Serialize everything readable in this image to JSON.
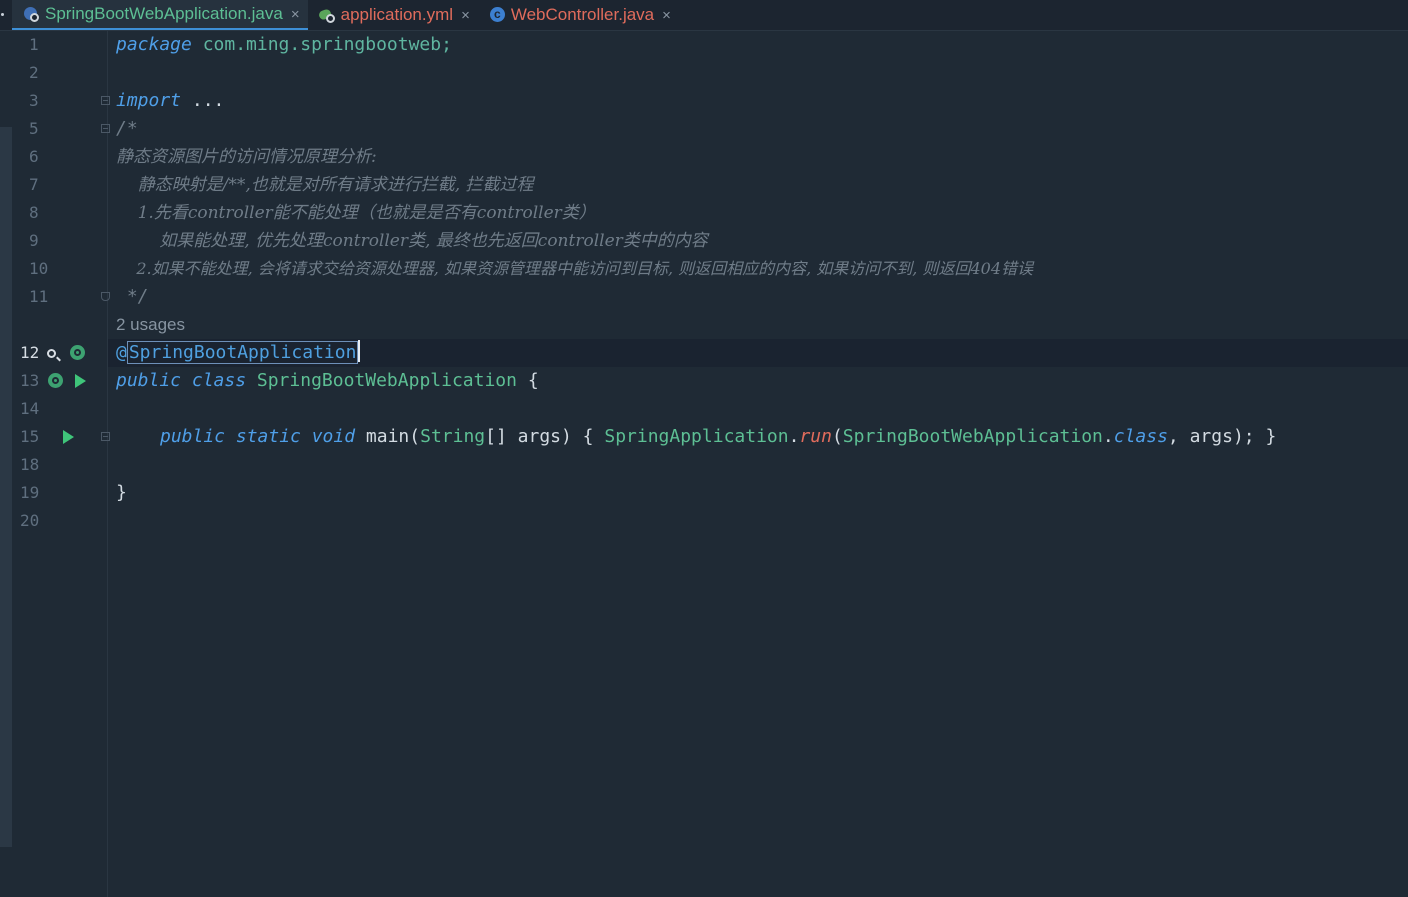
{
  "tabs": [
    {
      "label": "SpringBootWebApplication.java",
      "icon": "spring-boot-icon",
      "color": "#5dbf94",
      "active": true
    },
    {
      "label": "application.yml",
      "icon": "yml-icon",
      "color": "#e06c5c",
      "active": false
    },
    {
      "label": "WebController.java",
      "icon": "java-class-icon",
      "color": "#e06c5c",
      "active": false
    }
  ],
  "close_glyph": "×",
  "line_numbers": [
    "1",
    "2",
    "3",
    "5",
    "6",
    "7",
    "8",
    "9",
    "10",
    "11",
    "12",
    "13",
    "14",
    "15",
    "18",
    "19",
    "20"
  ],
  "code": {
    "l1_kw": "package",
    "l1_pkg": " com.ming.springbootweb;",
    "l3_kw": "import",
    "l3_rest": " ...",
    "l5": "/*",
    "l6": "静态资源图片的访问情况原理分析:",
    "l7": "    静态映射是/**,也就是对所有请求进行拦截, 拦截过程",
    "l8": "    1.先看controller能不能处理（也就是是否有controller类）",
    "l9": "        如果能处理, 优先处理controller类, 最终也先返回controller类中的内容",
    "l10": "    2.如果不能处理, 会将请求交给资源处理器, 如果资源管理器中能访问到目标, 则返回相应的内容, 如果访问不到, 则返回404错误",
    "l11": " */",
    "usages": "2 usages",
    "l12_at": "@",
    "l12_name": "SpringBootApplication",
    "l13_kw": "public class",
    "l13_cls": " SpringBootWebApplication",
    "l13_brace": " {",
    "l15_kw1": "public static void",
    "l15_mth": " main",
    "l15_p1": "(",
    "l15_type": "String",
    "l15_p2": "[] args) { ",
    "l15_cls": "SpringApplication",
    "l15_dot": ".",
    "l15_run": "run",
    "l15_p3": "(",
    "l15_cls2": "SpringBootWebApplication",
    "l15_dot2": ".",
    "l15_kw2": "class",
    "l15_p4": ", args",
    "l15_p5": "); }",
    "l19": "}"
  },
  "colors": {
    "keyword": "#4f9fe8",
    "class": "#5dbf94",
    "comment": "#6f7c88",
    "static_method": "#e06c5c",
    "background": "#1f2a35"
  }
}
